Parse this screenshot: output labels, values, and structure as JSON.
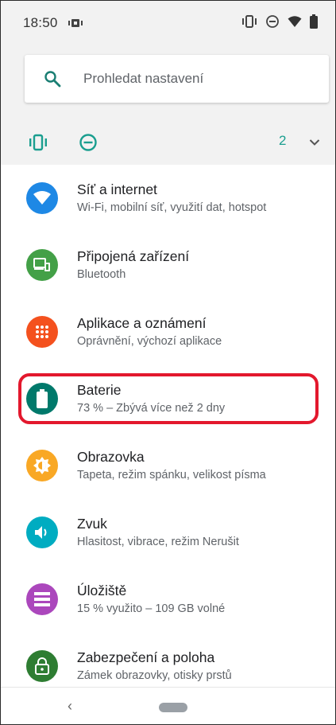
{
  "status_bar": {
    "time": "18:50"
  },
  "search": {
    "placeholder": "Prohledat nastavení"
  },
  "conditions": {
    "count": "2"
  },
  "settings_items": [
    {
      "title": "Síť a internet",
      "subtitle": "Wi-Fi, mobilní síť, využití dat, hotspot",
      "icon": "wifi-icon",
      "color": "#1e88e5"
    },
    {
      "title": "Připojená zařízení",
      "subtitle": "Bluetooth",
      "icon": "devices-icon",
      "color": "#43a047"
    },
    {
      "title": "Aplikace a oznámení",
      "subtitle": "Oprávnění, výchozí aplikace",
      "icon": "apps-icon",
      "color": "#f4511e"
    },
    {
      "title": "Baterie",
      "subtitle": "73 % – Zbývá více než 2 dny",
      "icon": "battery-icon",
      "color": "#00796b"
    },
    {
      "title": "Obrazovka",
      "subtitle": "Tapeta, režim spánku, velikost písma",
      "icon": "brightness-icon",
      "color": "#f9a825"
    },
    {
      "title": "Zvuk",
      "subtitle": "Hlasitost, vibrace, režim Nerušit",
      "icon": "volume-icon",
      "color": "#00acc1"
    },
    {
      "title": "Úložiště",
      "subtitle": "15 % využito – 109 GB volné",
      "icon": "storage-icon",
      "color": "#ab47bc"
    },
    {
      "title": "Zabezpečení a poloha",
      "subtitle": "Zámek obrazovky, otisky prstů",
      "icon": "lock-icon",
      "color": "#2e7d32"
    }
  ],
  "highlight": {
    "color": "#e3182d",
    "target": "Baterie"
  },
  "nav_bar": {
    "back": "‹"
  }
}
